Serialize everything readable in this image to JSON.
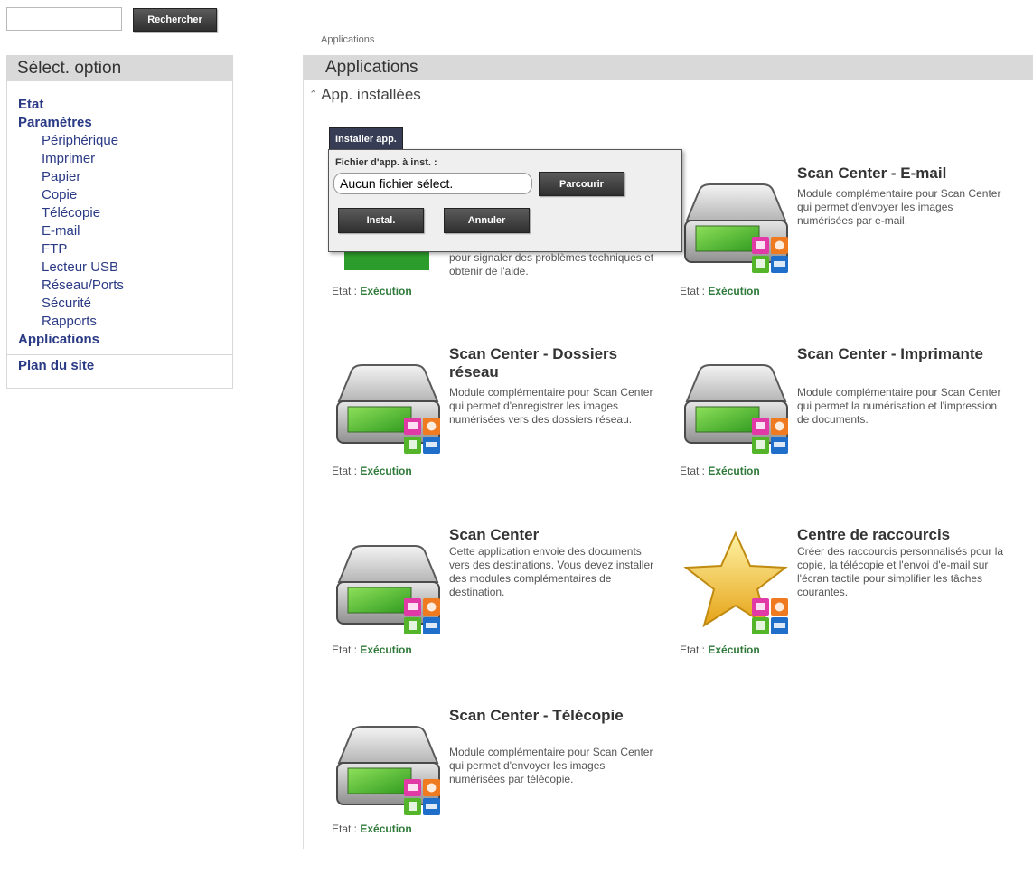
{
  "search": {
    "placeholder": "",
    "button_label": "Rechercher"
  },
  "sidebar": {
    "header": "Sélect. option",
    "items": [
      {
        "label": "Etat"
      },
      {
        "label": "Paramètres"
      },
      {
        "label": "Périphérique"
      },
      {
        "label": "Imprimer"
      },
      {
        "label": "Papier"
      },
      {
        "label": "Copie"
      },
      {
        "label": "Télécopie"
      },
      {
        "label": "E-mail"
      },
      {
        "label": "FTP"
      },
      {
        "label": "Lecteur USB"
      },
      {
        "label": "Réseau/Ports"
      },
      {
        "label": "Sécurité"
      },
      {
        "label": "Rapports"
      },
      {
        "label": "Applications"
      }
    ],
    "site_map": "Plan du site"
  },
  "breadcrumb": "Applications",
  "main": {
    "title": "Applications",
    "section": "App. installées",
    "status_label": "Etat :",
    "status_value": "Exécution"
  },
  "apps": [
    {
      "title": "",
      "desc": "pour signaler des problèmes techniques et obtenir de l'aide."
    },
    {
      "title": "Scan Center - E-mail",
      "desc": "Module complémentaire pour Scan Center qui permet d'envoyer les images numérisées par e-mail."
    },
    {
      "title": "Scan Center - Dossiers réseau",
      "desc": "Module complémentaire pour Scan Center qui permet d'enregistrer les images numérisées vers des dossiers réseau."
    },
    {
      "title": "Scan Center - Imprimante",
      "desc": "Module complémentaire pour Scan Center qui permet la numérisation et l'impression de documents."
    },
    {
      "title": "Scan Center",
      "desc": "Cette application envoie des documents vers des destinations. Vous devez installer des modules complémentaires de destination."
    },
    {
      "title": "Centre de raccourcis",
      "desc": "Créer des raccourcis personnalisés pour la copie, la télécopie et l'envoi d'e-mail sur l'écran tactile pour simplifier les tâches courantes."
    },
    {
      "title": "Scan Center - Télécopie",
      "desc": "Module complémentaire pour Scan Center qui permet d'envoyer les images numérisées par télécopie."
    }
  ],
  "install_popup": {
    "tab_label": "Installer app.",
    "file_label": "Fichier d'app. à inst. :",
    "file_value": "Aucun fichier sélect.",
    "browse_label": "Parcourir",
    "install_label": "Instal.",
    "cancel_label": "Annuler"
  }
}
